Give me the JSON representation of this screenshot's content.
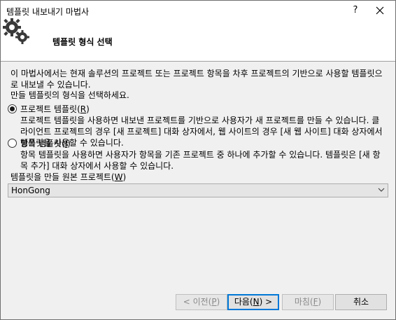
{
  "window": {
    "title": "템플릿 내보내기 마법사",
    "help_label": "?"
  },
  "header": {
    "title": "템플릿 형식 선택",
    "icon": "gear-wizard-icon"
  },
  "content": {
    "intro": "이 마법사에서는 현재 솔루션의 프로젝트 또는 프로젝트 항목을 차후 프로젝트의 기반으로 사용할 템플릿으로 내보낼 수 있습니다.",
    "prompt": "만들 템플릿의 형식을 선택하세요.",
    "options": [
      {
        "label_before": "프로젝트 템플릿(",
        "mnemonic": "R",
        "label_after": ")",
        "checked": true,
        "description": "프로젝트 템플릿을 사용하면 내보낸 프로젝트를 기반으로 사용자가 새 프로젝트를 만들 수 있습니다. 클라이언트 프로젝트의 경우 [새 프로젝트] 대화 상자에서, 웹 사이트의 경우 [새 웹 사이트] 대화 상자에서 템플릿을 사용할 수 있습니다."
      },
      {
        "label_before": "항목 템플릿(",
        "mnemonic": "I",
        "label_after": ")",
        "checked": false,
        "description": "항목 템플릿을 사용하면 사용자가 항목을 기존 프로젝트 중 하나에 추가할 수 있습니다. 템플릿은 [새 항목 추가] 대화 상자에서 사용할 수 있습니다."
      }
    ],
    "source_label_before": "템플릿을 만들 원본 프로젝트(",
    "source_label_mnemonic": "W",
    "source_label_after": ")",
    "source_value": "HonGong"
  },
  "footer": {
    "prev_before": "< 이전(",
    "prev_mnemonic": "P",
    "prev_after": ")",
    "next_before": "다음(",
    "next_mnemonic": "N",
    "next_after": ") >",
    "finish_before": "마침(",
    "finish_mnemonic": "F",
    "finish_after": ")",
    "cancel_label": "취소"
  },
  "colors": {
    "accent": "#0078d7",
    "disabled_text": "#8a8a8a"
  }
}
